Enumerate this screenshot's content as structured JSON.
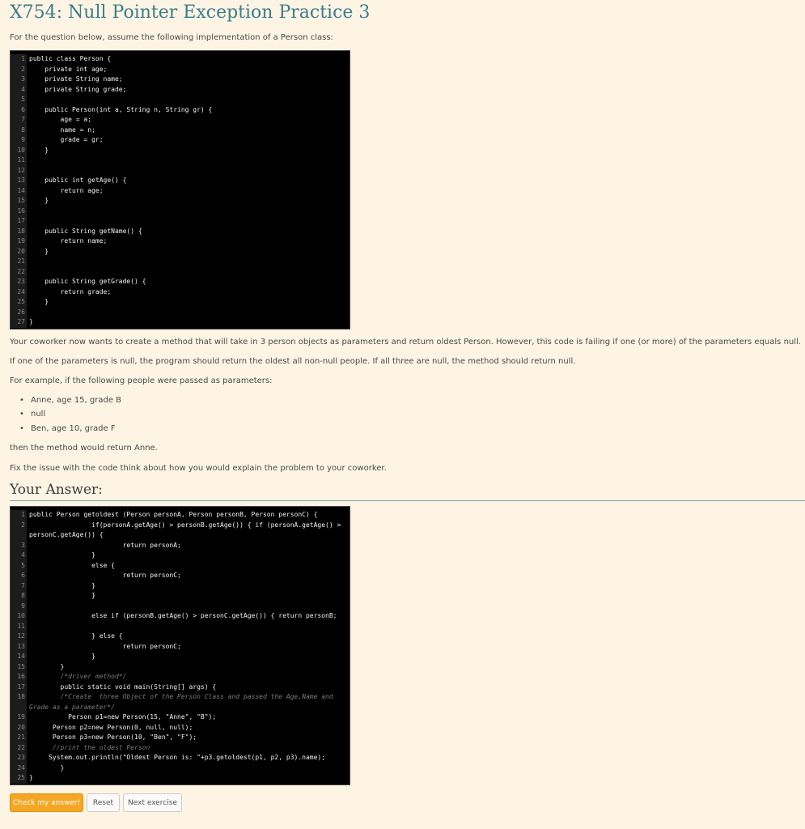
{
  "page": {
    "title": "X754: Null Pointer Exception Practice 3",
    "intro": "For the question below, assume the following implementation of a Person class:",
    "para1": "Your coworker now wants to create a method that will take in 3 person objects as parameters and return oldest Person. However, this code is failing if one (or more) of the parameters equals null.",
    "para2": "If one of the parameters is null, the program should return the oldest all non-null people. If all three are null, the method should return null.",
    "para3": "For example, if the following people were passed as parameters:",
    "bullets": [
      "Anne, age 15, grade B",
      "null",
      "Ben, age 10, grade F"
    ],
    "para4": "then the method would return Anne.",
    "para5": "Fix the issue with the code think about how you would explain the problem to your coworker.",
    "answer_heading": "Your Answer:"
  },
  "class_code": [
    {
      "n": "1",
      "t": "public class Person {"
    },
    {
      "n": "2",
      "t": "    private int age;"
    },
    {
      "n": "3",
      "t": "    private String name;"
    },
    {
      "n": "4",
      "t": "    private String grade;"
    },
    {
      "n": "5",
      "t": ""
    },
    {
      "n": "6",
      "t": "    public Person(int a, String n, String gr) {"
    },
    {
      "n": "7",
      "t": "        age = a;"
    },
    {
      "n": "8",
      "t": "        name = n;"
    },
    {
      "n": "9",
      "t": "        grade = gr;"
    },
    {
      "n": "10",
      "t": "    }"
    },
    {
      "n": "11",
      "t": ""
    },
    {
      "n": "12",
      "t": ""
    },
    {
      "n": "13",
      "t": "    public int getAge() {"
    },
    {
      "n": "14",
      "t": "        return age;"
    },
    {
      "n": "15",
      "t": "    }"
    },
    {
      "n": "16",
      "t": ""
    },
    {
      "n": "17",
      "t": ""
    },
    {
      "n": "18",
      "t": "    public String getName() {"
    },
    {
      "n": "19",
      "t": "        return name;"
    },
    {
      "n": "20",
      "t": "    }"
    },
    {
      "n": "21",
      "t": ""
    },
    {
      "n": "22",
      "t": ""
    },
    {
      "n": "23",
      "t": "    public String getGrade() {"
    },
    {
      "n": "24",
      "t": "        return grade;"
    },
    {
      "n": "25",
      "t": "    }"
    },
    {
      "n": "26",
      "t": ""
    },
    {
      "n": "27",
      "t": "}"
    }
  ],
  "answer_code": [
    {
      "n": "1",
      "t": "public Person getoldest (Person personA, Person personB, Person personC) {"
    },
    {
      "n": "2",
      "t": "                if(personA.getAge() > personB.getAge()) { if (personA.getAge() > personC.getAge()) {",
      "wrap": true
    },
    {
      "n": "3",
      "t": "                        return personA;"
    },
    {
      "n": "4",
      "t": "                }"
    },
    {
      "n": "5",
      "t": "                else {"
    },
    {
      "n": "6",
      "t": "                        return personC;"
    },
    {
      "n": "7",
      "t": "                }"
    },
    {
      "n": "8",
      "t": "                }"
    },
    {
      "n": "9",
      "t": ""
    },
    {
      "n": "10",
      "t": "                else if (personB.getAge() > personC.getAge()) { return personB;"
    },
    {
      "n": "11",
      "t": ""
    },
    {
      "n": "12",
      "t": "                } else {"
    },
    {
      "n": "13",
      "t": "                        return personC;"
    },
    {
      "n": "14",
      "t": "                }"
    },
    {
      "n": "15",
      "t": "        }"
    },
    {
      "n": "16",
      "t": "        /*driver method*/",
      "comment": true
    },
    {
      "n": "17",
      "t": "        public static void main(String[] args) {"
    },
    {
      "n": "18",
      "t": "        /*Create  three Object of the Person Class and passed the Age,Name and Grade as a parameter*/",
      "wrap": true,
      "comment": true
    },
    {
      "n": "19",
      "t": "          Person p1=new Person(15, \"Anne\", \"B\");"
    },
    {
      "n": "20",
      "t": "      Person p2=new Person(0, null, null);"
    },
    {
      "n": "21",
      "t": "      Person p3=new Person(10, \"Ben\", \"F\");"
    },
    {
      "n": "22",
      "t": "      //print the oldest Person",
      "comment": true
    },
    {
      "n": "23",
      "t": "     System.out.println(\"Oldest Person is: \"+p3.getoldest(p1, p2, p3).name);"
    },
    {
      "n": "24",
      "t": "        }"
    },
    {
      "n": "25",
      "t": "}"
    }
  ],
  "buttons": {
    "check": "Check my answer!",
    "reset": "Reset",
    "next": "Next exercise"
  }
}
